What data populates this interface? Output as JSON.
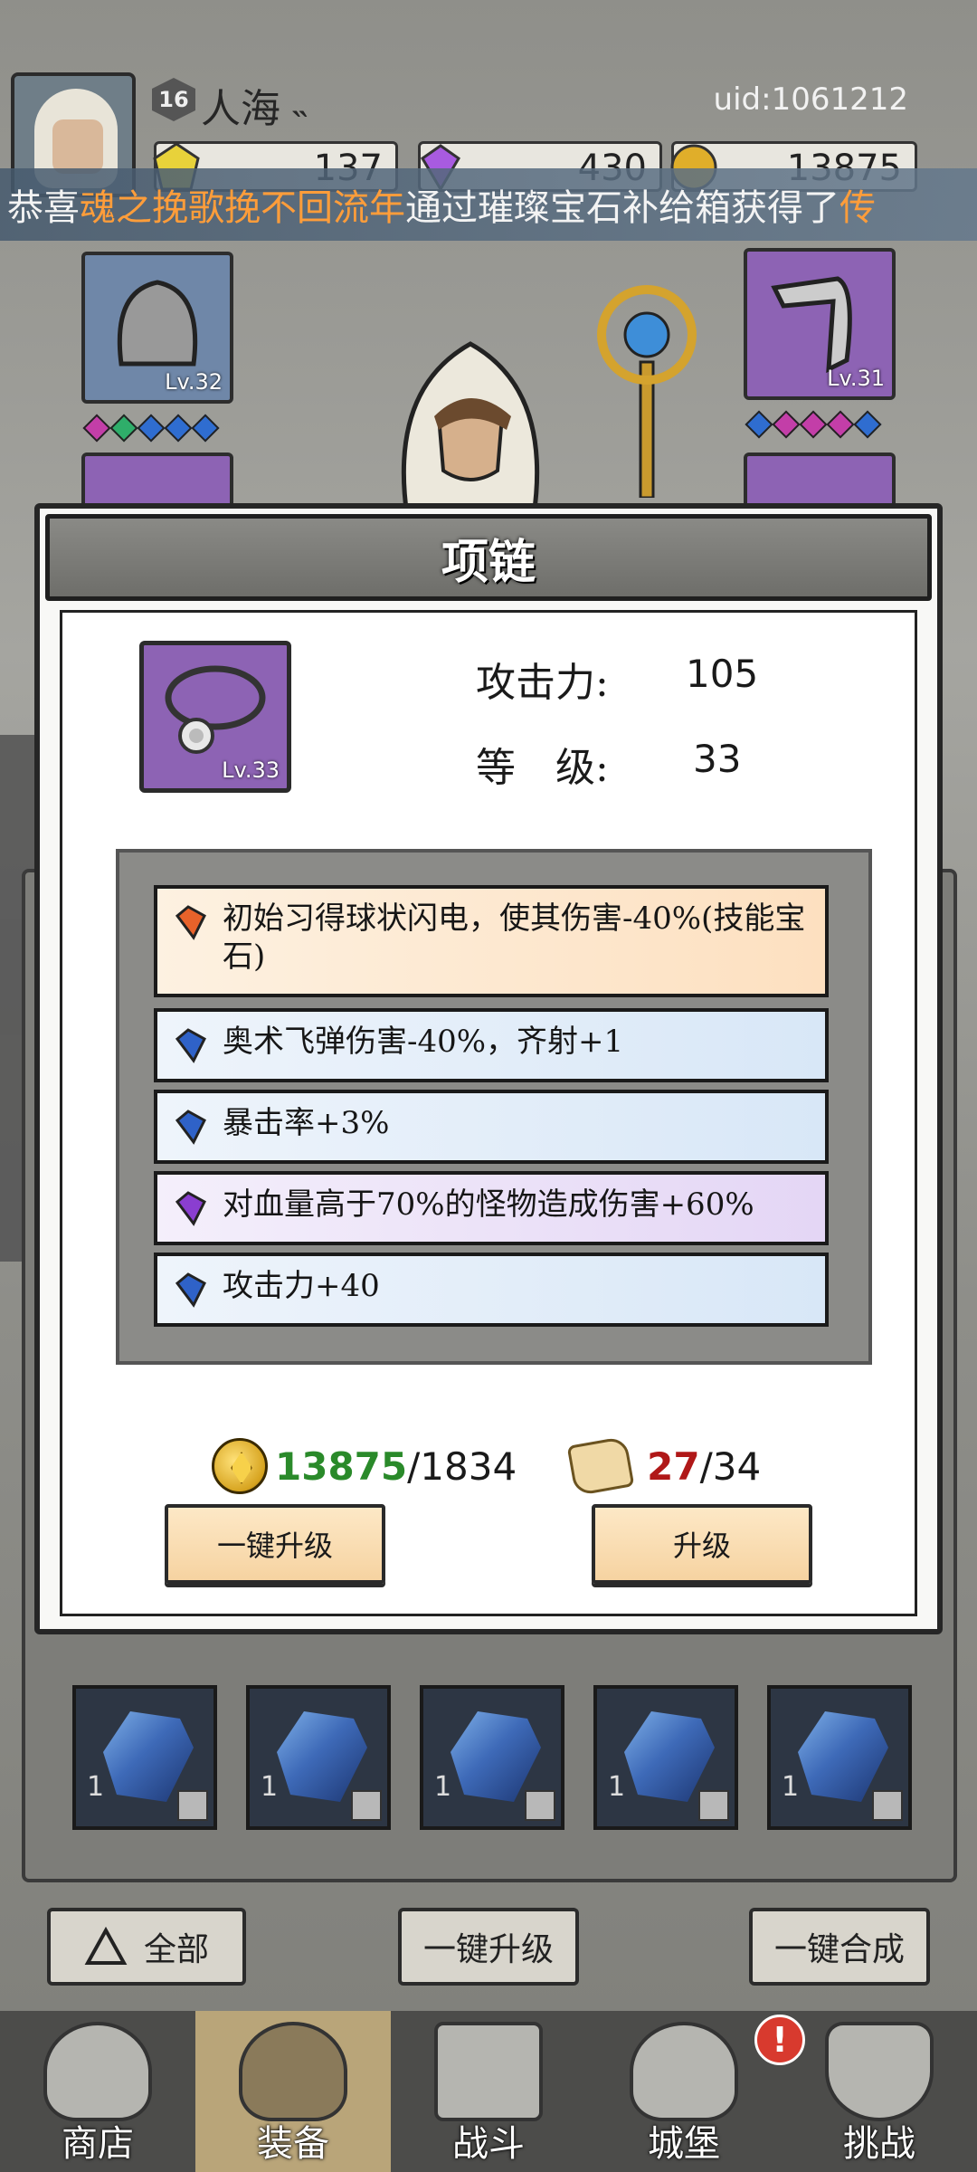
{
  "player": {
    "level": "16",
    "name": "人海",
    "uid": "uid:1061212"
  },
  "currencies": {
    "energy": "137",
    "gems": "430",
    "gold": "13875"
  },
  "ticker": {
    "prefix": "恭喜",
    "player_name": "魂之挽歌挽不回流年",
    "suffix": "通过璀璨宝石补给箱获得了",
    "tail": "传"
  },
  "equipment": {
    "left_top_lv": "Lv.32",
    "right_top_lv": "Lv.31"
  },
  "modal": {
    "title": "项链",
    "item_level": "Lv.33",
    "attack_label": "攻击力:",
    "attack_value": "105",
    "level_label": "等　级:",
    "level_value": "33",
    "affixes": [
      {
        "color": "orange",
        "text": "初始习得球状闪电，使其伤害-40%(技能宝石)"
      },
      {
        "color": "blue",
        "text": "奥术飞弹伤害-40%，齐射+1"
      },
      {
        "color": "blue",
        "text": "暴击率+3%"
      },
      {
        "color": "purple",
        "text": "对血量高于70%的怪物造成伤害+60%"
      },
      {
        "color": "blue",
        "text": "攻击力+40"
      }
    ],
    "gold_have": "13875",
    "gold_need": "/1834",
    "scroll_have": "27",
    "scroll_need": "/34",
    "btn_upgrade_all": "一键升级",
    "btn_upgrade": "升级"
  },
  "inventory": {
    "count": "1"
  },
  "bottom_buttons": {
    "filter_all": "全部",
    "upgrade_all": "一键升级",
    "merge_all": "一键合成"
  },
  "nav": {
    "shop": "商店",
    "equip": "装备",
    "battle": "战斗",
    "castle": "城堡",
    "challenge": "挑战",
    "alert": "!"
  },
  "colors": {
    "accent_orange": "#ff9d3a",
    "gold_green": "#2a8a2a",
    "scroll_red": "#b01818",
    "purple_rarity": "#8d63b4",
    "blue_rarity": "#6f87a8"
  }
}
